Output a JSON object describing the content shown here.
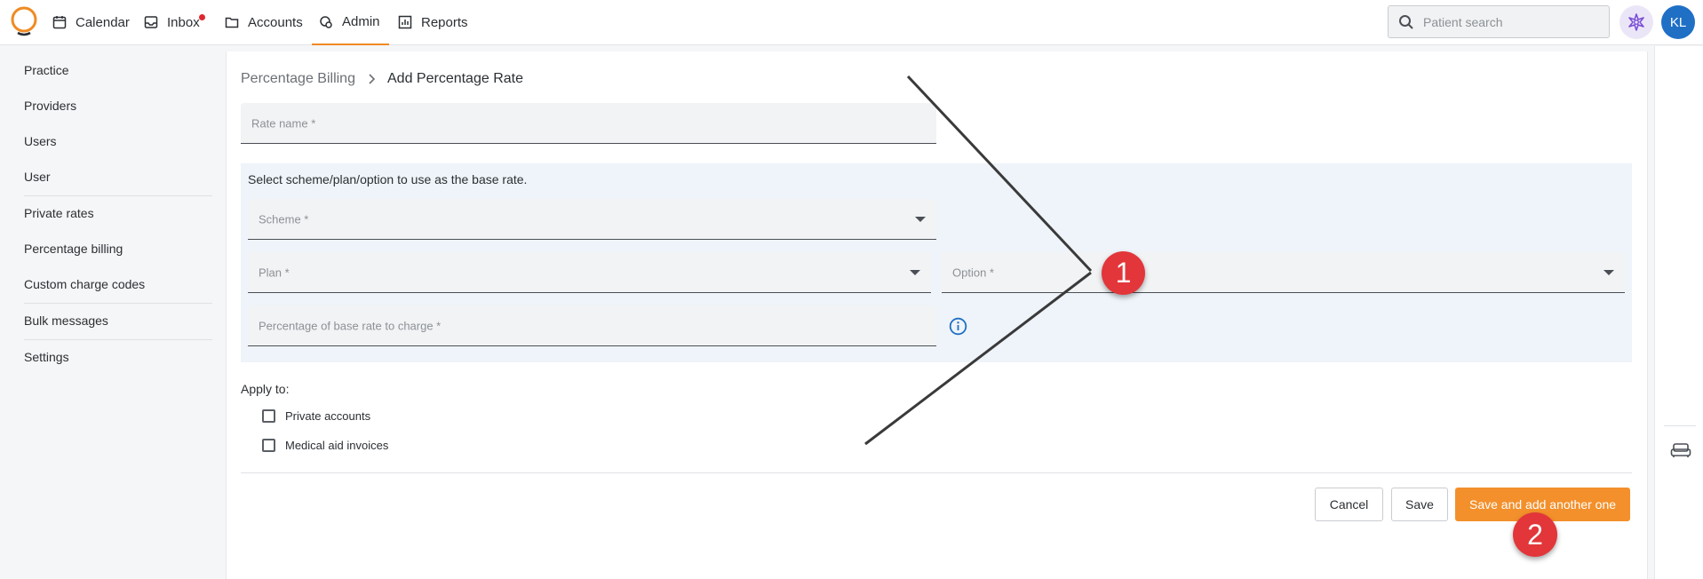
{
  "nav": {
    "items": [
      {
        "label": "Calendar",
        "icon": "calendar-icon"
      },
      {
        "label": "Inbox",
        "icon": "inbox-icon",
        "has_notification": true
      },
      {
        "label": "Accounts",
        "icon": "folder-icon"
      },
      {
        "label": "Admin",
        "icon": "admin-icon",
        "active": true
      },
      {
        "label": "Reports",
        "icon": "reports-icon"
      }
    ],
    "search_placeholder": "Patient search",
    "avatar_initials": "KL"
  },
  "sidebar": {
    "items": [
      {
        "label": "Practice"
      },
      {
        "label": "Providers"
      },
      {
        "label": "Users"
      },
      {
        "label": "User"
      },
      {
        "label": "Private rates"
      },
      {
        "label": "Percentage billing"
      },
      {
        "label": "Custom charge codes"
      },
      {
        "label": "Bulk messages"
      },
      {
        "label": "Settings"
      }
    ]
  },
  "breadcrumb": {
    "parent": "Percentage Billing",
    "current": "Add Percentage Rate"
  },
  "form": {
    "rate_name_placeholder": "Rate name *",
    "base_rate_instruction": "Select scheme/plan/option to use as the base rate.",
    "scheme_placeholder": "Scheme *",
    "plan_placeholder": "Plan *",
    "option_placeholder": "Option *",
    "percentage_placeholder": "Percentage of base rate to charge *",
    "apply_to_label": "Apply to:",
    "checkboxes": [
      {
        "label": "Private accounts",
        "checked": false
      },
      {
        "label": "Medical aid invoices",
        "checked": false
      }
    ]
  },
  "actions": {
    "cancel": "Cancel",
    "save": "Save",
    "save_and_add": "Save and add another one"
  },
  "annotations": {
    "badge_1": "1",
    "badge_2": "2"
  },
  "colors": {
    "accent": "#f3902b",
    "badge": "#e2363a",
    "avatar": "#1f6fc5",
    "section_bg": "#eef4f9"
  }
}
